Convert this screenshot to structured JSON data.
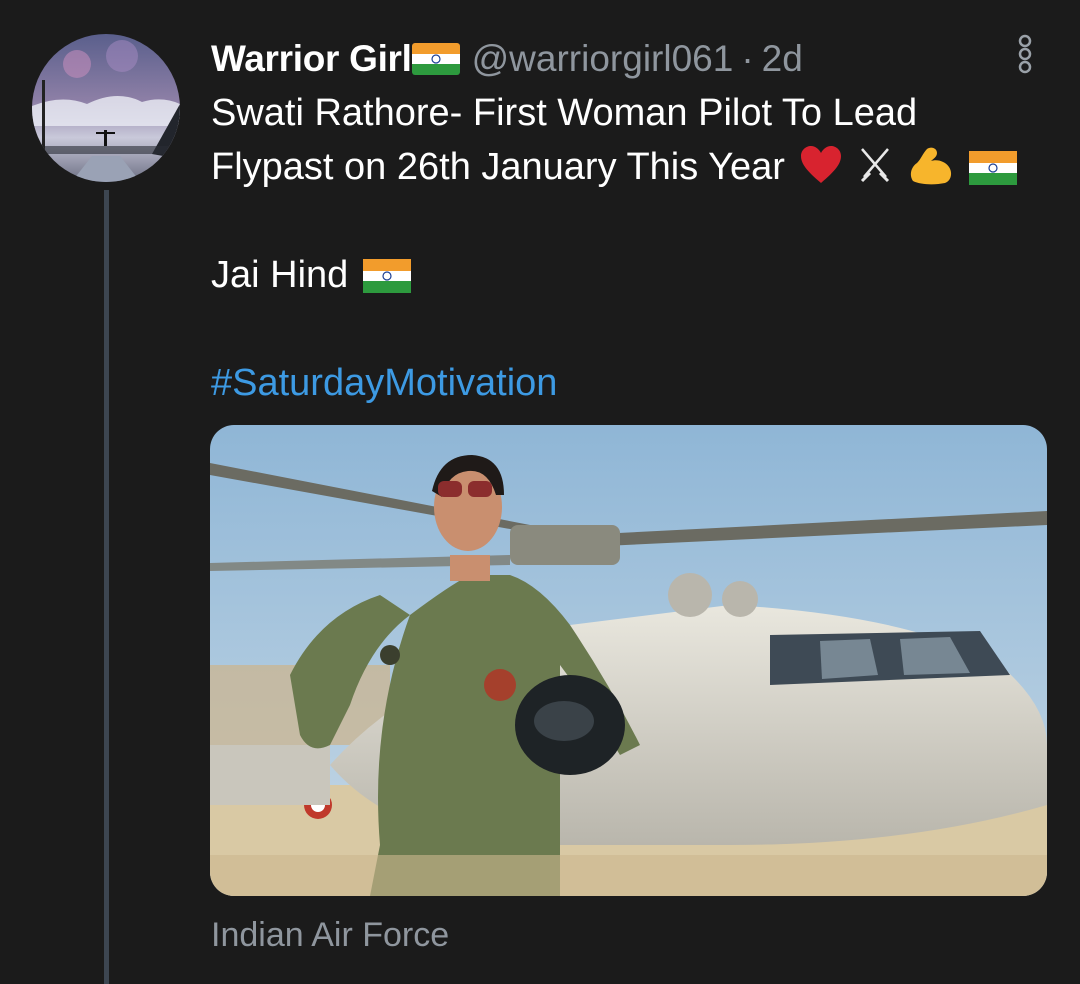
{
  "tweet": {
    "display_name": "Warrior Girl",
    "handle": "@warriorgirl061",
    "separator": "·",
    "time": "2d",
    "line1": "Swati Rathore- First Woman Pilot To Lead",
    "line2": "Flypast on 26th January This Year",
    "line3": "Jai Hind",
    "hashtag": "#SaturdayMotivation",
    "media_source": "Indian Air Force"
  },
  "icons": {
    "flag": "indian-flag-icon",
    "heart": "red-heart-icon",
    "swords": "crossed-swords-icon",
    "muscle": "flexed-biceps-icon",
    "more": "vertical-more-icon"
  },
  "colors": {
    "background": "#1b1b1b",
    "text": "#ffffff",
    "secondary": "#8f969e",
    "link": "#3d9ae3",
    "thread_line": "#3d4651"
  }
}
